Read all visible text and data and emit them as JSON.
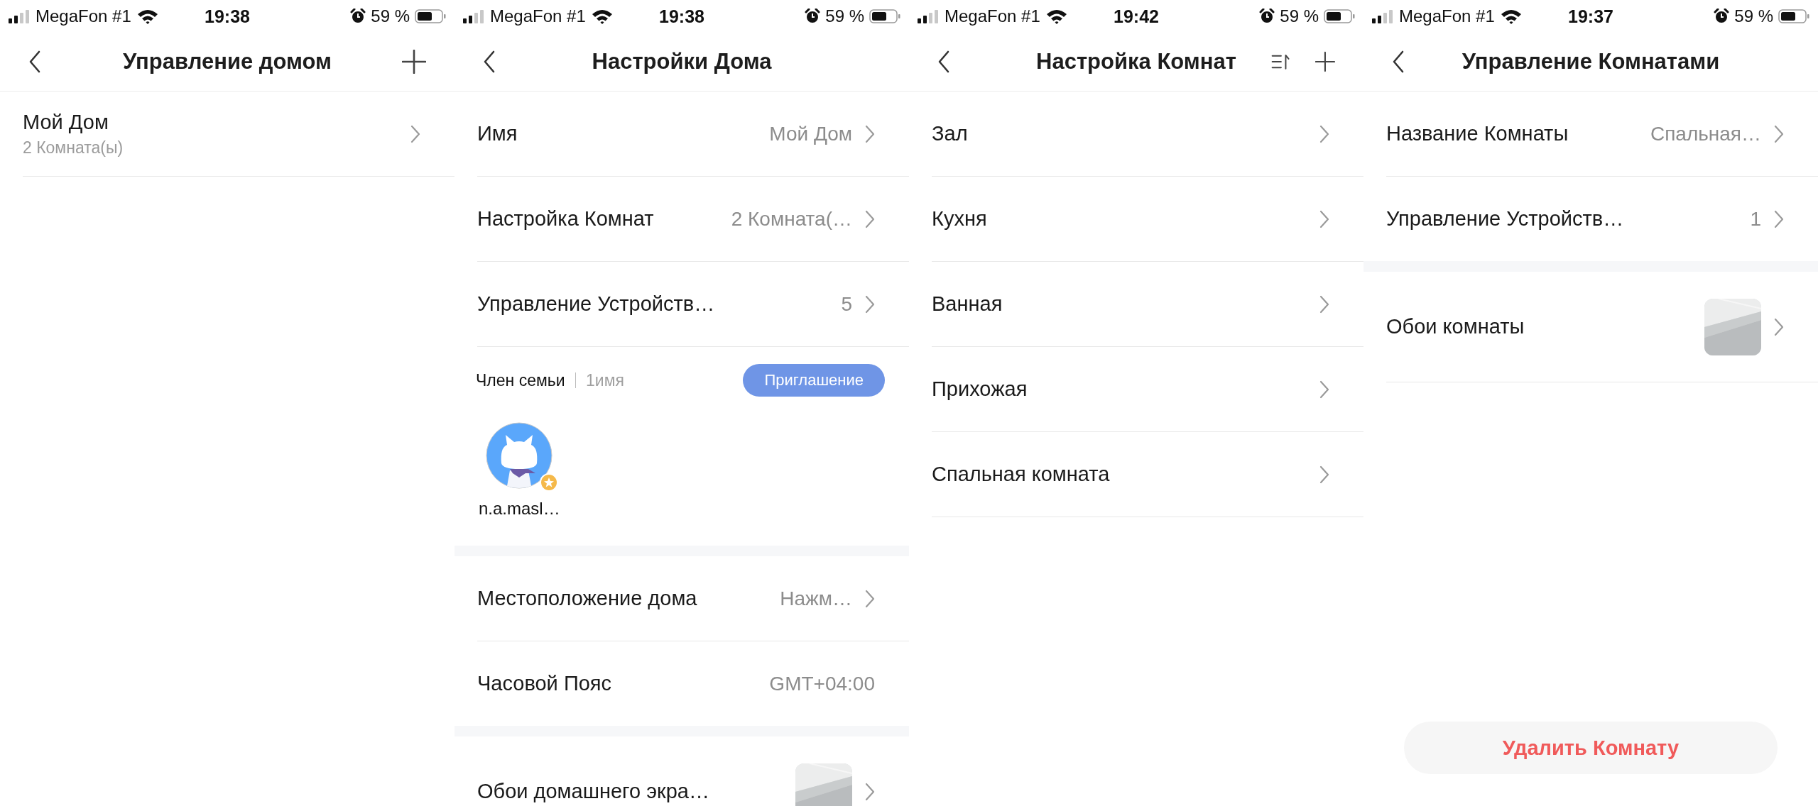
{
  "screens": [
    {
      "status_bar": {
        "carrier": "MegaFon #1",
        "time": "19:38",
        "battery": "59 %"
      },
      "title": "Управление домом",
      "actions": [
        {
          "kind": "add"
        }
      ],
      "sections": [
        {
          "kind": "rows",
          "rows": [
            {
              "label": "Мой Дом",
              "sublabel": "2 Комната(ы)"
            }
          ]
        }
      ]
    },
    {
      "status_bar": {
        "carrier": "MegaFon #1",
        "time": "19:38",
        "battery": "59 %"
      },
      "title": "Настройки Дома",
      "sections": [
        {
          "kind": "rows",
          "rows": [
            {
              "label": "Имя",
              "value": "Мой Дом"
            },
            {
              "label": "Настройка Комнат",
              "value": "2 Комната(…"
            },
            {
              "label": "Управление Устройств…",
              "value": "5"
            }
          ]
        },
        {
          "kind": "members",
          "title": "Член семьи",
          "count": "1имя",
          "invite": "Приглашение",
          "members": [
            {
              "name": "n.a.masl…",
              "owner": true
            }
          ]
        },
        {
          "kind": "gap"
        },
        {
          "kind": "rows",
          "rows": [
            {
              "label": "Местоположение дома",
              "value": "Нажм…"
            },
            {
              "label": "Часовой Пояс",
              "value": "GMT+04:00",
              "chevron": false
            }
          ]
        },
        {
          "kind": "gap"
        },
        {
          "kind": "rows",
          "rows": [
            {
              "label": "Обои домашнего экра…"
            }
          ]
        }
      ]
    },
    {
      "status_bar": {
        "carrier": "MegaFon #1",
        "time": "19:42",
        "battery": "59 %"
      },
      "title": "Настройка Комнат",
      "actions": [
        {
          "kind": "sort"
        },
        {
          "kind": "add"
        }
      ],
      "sections": [
        {
          "kind": "rows",
          "rows": [
            {
              "label": "Зал"
            },
            {
              "label": "Кухня"
            },
            {
              "label": "Ванная"
            },
            {
              "label": "Прихожая"
            },
            {
              "label": "Спальная комната"
            }
          ]
        }
      ]
    },
    {
      "status_bar": {
        "carrier": "MegaFon #1",
        "time": "19:37",
        "battery": "59 %"
      },
      "title": "Управление Комнатами",
      "sections": [
        {
          "kind": "rows",
          "rows": [
            {
              "label": "Название Комнаты",
              "value": "Спальная…"
            },
            {
              "label": "Управление Устройств…",
              "value": "1"
            }
          ]
        },
        {
          "kind": "gap"
        },
        {
          "kind": "rows",
          "rows": [
            {
              "label": "Обои комнаты"
            }
          ]
        },
        {
          "kind": "button",
          "label": "Удалить Комнату"
        }
      ]
    }
  ]
}
